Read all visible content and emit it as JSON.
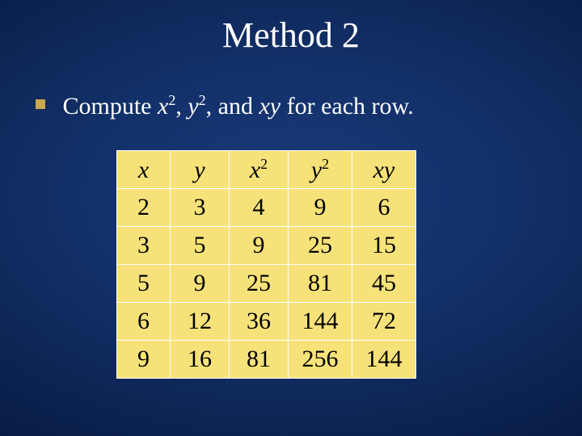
{
  "title": "Method 2",
  "bullet": {
    "prefix": "Compute ",
    "var1": "x",
    "exp1": "2",
    "sep1": ", ",
    "var2": "y",
    "exp2": "2",
    "sep2": ", and ",
    "var3": "xy",
    "suffix": " for each row."
  },
  "chart_data": {
    "type": "table",
    "headers": {
      "x": {
        "base": "x",
        "sup": ""
      },
      "y": {
        "base": "y",
        "sup": ""
      },
      "x2": {
        "base": "x",
        "sup": "2"
      },
      "y2": {
        "base": "y",
        "sup": "2"
      },
      "xy": {
        "base": "xy",
        "sup": ""
      }
    },
    "rows": [
      {
        "x": "2",
        "y": "3",
        "x2": "4",
        "y2": "9",
        "xy": "6"
      },
      {
        "x": "3",
        "y": "5",
        "x2": "9",
        "y2": "25",
        "xy": "15"
      },
      {
        "x": "5",
        "y": "9",
        "x2": "25",
        "y2": "81",
        "xy": "45"
      },
      {
        "x": "6",
        "y": "12",
        "x2": "36",
        "y2": "144",
        "xy": "72"
      },
      {
        "x": "9",
        "y": "16",
        "x2": "81",
        "y2": "256",
        "xy": "144"
      }
    ]
  }
}
